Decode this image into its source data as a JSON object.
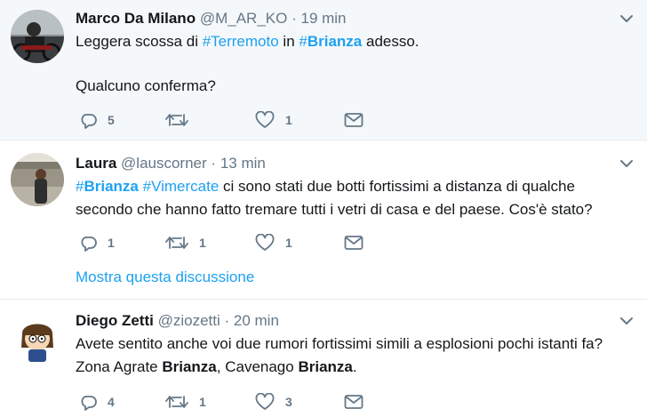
{
  "tweets": [
    {
      "name": "Marco Da Milano",
      "handle": "@M_AR_KO",
      "dot": "·",
      "time": "19 min",
      "line1": {
        "a": "Leggera scossa di ",
        "tag1": "#Terremoto",
        "b": " in ",
        "tag2_hash": "#",
        "tag2_word": "Brianza",
        "c": " adesso."
      },
      "line2": "Qualcuno conferma?",
      "replies": "5",
      "retweets": "",
      "likes": "1"
    },
    {
      "name": "Laura",
      "handle": "@lauscorner",
      "dot": "·",
      "time": "13 min",
      "line1": {
        "tag1_hash": "#",
        "tag1_word": "Brianza",
        "sp": " ",
        "tag2": "#Vimercate",
        "rest": " ci sono stati due botti fortissimi a distanza di qualche"
      },
      "line2": "secondo che hanno fatto tremare tutti i vetri di casa e del paese. Cos'è stato?",
      "replies": "1",
      "retweets": "1",
      "likes": "1",
      "thread_link": "Mostra questa discussione"
    },
    {
      "name": "Diego Zetti",
      "handle": "@ziozetti",
      "dot": "·",
      "time": "20 min",
      "line1": "Avete sentito anche voi due rumori fortissimi simili a esplosioni pochi istanti fa?",
      "line2": {
        "a": "Zona Agrate ",
        "b1": "Brianza",
        "c": ", Cavenago ",
        "b2": "Brianza",
        "d": "."
      },
      "replies": "4",
      "retweets": "1",
      "likes": "3"
    }
  ],
  "colors": {
    "accent": "#1da1f2",
    "muted": "#657786",
    "highlight_bg": "#f5f8fa"
  },
  "icons": [
    "reply-icon",
    "retweet-icon",
    "like-icon",
    "message-icon",
    "caret-down-icon"
  ]
}
